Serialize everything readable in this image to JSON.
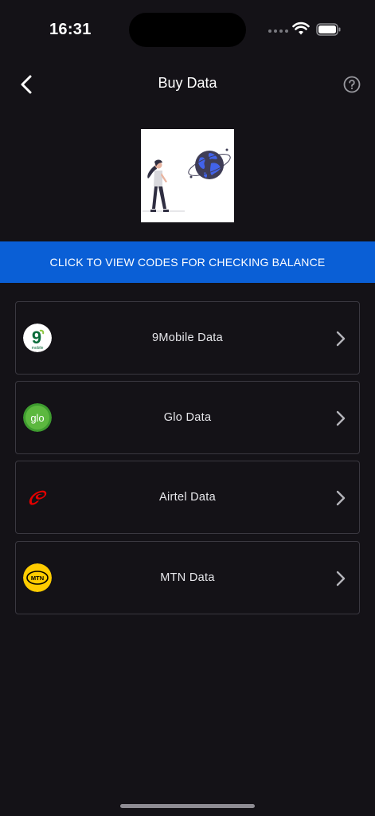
{
  "status_bar": {
    "time": "16:31"
  },
  "nav": {
    "title": "Buy Data",
    "back_icon": "chevron-left-icon",
    "help_icon": "question-circle-icon"
  },
  "illustration": {
    "icon": "woman-with-globe-illustration"
  },
  "banner": {
    "label": "CLICK TO VIEW CODES FOR CHECKING BALANCE",
    "color": "#0a5fd6"
  },
  "networks": [
    {
      "label": "9Mobile Data",
      "logo": "9mobile-logo",
      "logo_text": "9",
      "logo_subtext": "mobile"
    },
    {
      "label": "Glo Data",
      "logo": "glo-logo",
      "logo_text": "glo"
    },
    {
      "label": "Airtel Data",
      "logo": "airtel-logo"
    },
    {
      "label": "MTN Data",
      "logo": "mtn-logo",
      "logo_text": "MTN"
    }
  ],
  "colors": {
    "background": "#141217",
    "card_border": "#3a3840",
    "accent": "#0a5fd6"
  }
}
